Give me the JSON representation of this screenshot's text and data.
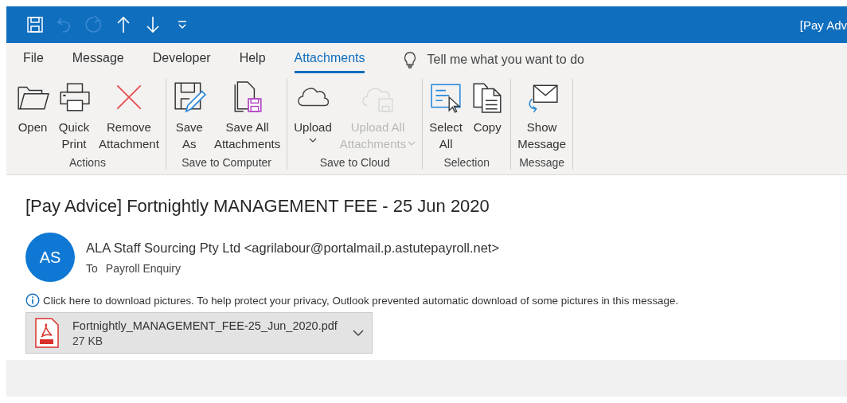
{
  "quick_access": [
    {
      "kind": "save",
      "disabled": false
    },
    {
      "kind": "undo",
      "disabled": true
    },
    {
      "kind": "redo",
      "disabled": true
    },
    {
      "kind": "up",
      "disabled": false
    },
    {
      "kind": "down",
      "disabled": false
    },
    {
      "kind": "customize",
      "disabled": false
    }
  ],
  "window": {
    "title": "[Pay Adv"
  },
  "tabs": [
    {
      "label": "File",
      "selected": false
    },
    {
      "label": "Message",
      "selected": false
    },
    {
      "label": "Developer",
      "selected": false
    },
    {
      "label": "Help",
      "selected": false
    },
    {
      "label": "Attachments",
      "selected": true
    }
  ],
  "tell_me": {
    "placeholder": "Tell me what you want to do"
  },
  "ribbon_groups": [
    {
      "label": "Actions",
      "buttons": [
        {
          "kind": "open",
          "label": "Open",
          "disabled": false,
          "dropdown": false
        },
        {
          "kind": "print",
          "label": "Quick\nPrint",
          "disabled": false,
          "dropdown": false
        },
        {
          "kind": "remove",
          "label": "Remove\nAttachment",
          "disabled": false,
          "dropdown": false
        }
      ]
    },
    {
      "label": "Save to Computer",
      "buttons": [
        {
          "kind": "save-as",
          "label": "Save\nAs",
          "disabled": false,
          "dropdown": false
        },
        {
          "kind": "save-all",
          "label": "Save All\nAttachments",
          "disabled": false,
          "dropdown": false
        }
      ]
    },
    {
      "label": "Save to Cloud",
      "buttons": [
        {
          "kind": "upload",
          "label": "Upload",
          "disabled": false,
          "dropdown": true
        },
        {
          "kind": "upload-all",
          "label": "Upload All\nAttachments",
          "disabled": true,
          "dropdown": true
        }
      ]
    },
    {
      "label": "Selection",
      "buttons": [
        {
          "kind": "select-all",
          "label": "Select\nAll",
          "disabled": false,
          "dropdown": false
        },
        {
          "kind": "copy",
          "label": "Copy",
          "disabled": false,
          "dropdown": false
        }
      ]
    },
    {
      "label": "Message",
      "buttons": [
        {
          "kind": "show-message",
          "label": "Show\nMessage",
          "disabled": false,
          "dropdown": false
        }
      ]
    }
  ],
  "message": {
    "subject": "[Pay Advice] Fortnightly MANAGEMENT FEE - 25 Jun 2020",
    "avatar_initials": "AS",
    "sender": "ALA Staff Sourcing Pty Ltd <agrilabour@portalmail.p.astutepayroll.net>",
    "to_label": "To",
    "recipient": "Payroll Enquiry",
    "info_bar": "Click here to download pictures. To help protect your privacy, Outlook prevented automatic download of some pictures in this message.",
    "attachment": {
      "name": "Fortnightly_MANAGEMENT_FEE-25_Jun_2020.pdf",
      "size": "27 KB"
    }
  }
}
